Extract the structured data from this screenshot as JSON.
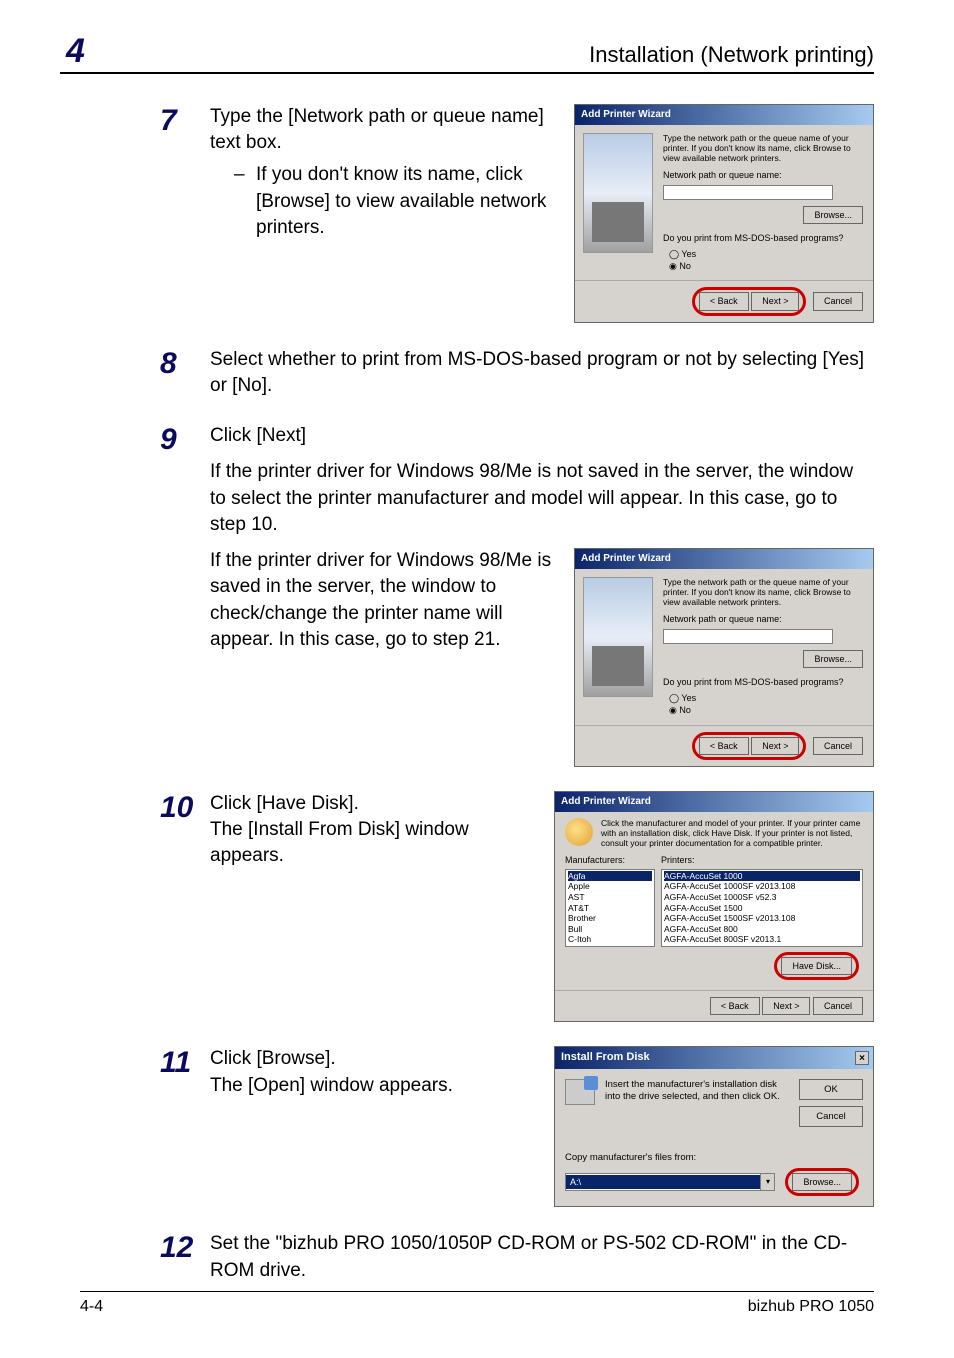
{
  "header": {
    "chapter": "4",
    "title": "Installation (Network printing)"
  },
  "steps": {
    "s7": {
      "num": "7",
      "text": "Type the [Network path or queue name] text box.",
      "bullet_dash": "–",
      "bullet": "If you don't know its name, click [Browse] to view available network printers."
    },
    "s8": {
      "num": "8",
      "text": "Select whether to print from MS-DOS-based program or not by selecting [Yes] or [No]."
    },
    "s9": {
      "num": "9",
      "line1": "Click [Next]",
      "para1": "If the printer driver for Windows 98/Me is not saved in the server, the window to select the printer manufacturer and model will appear. In this case, go to step 10.",
      "para2": "If the printer driver for Windows 98/Me is saved in the server, the window to check/change the printer name will appear. In this case, go to step 21."
    },
    "s10": {
      "num": "10",
      "line1": "Click [Have Disk].",
      "line2": "The [Install From Disk] window appears."
    },
    "s11": {
      "num": "11",
      "line1": "Click [Browse].",
      "line2": "The [Open] window appears."
    },
    "s12": {
      "num": "12",
      "text": "Set the \"bizhub PRO 1050/1050P CD-ROM or PS-502 CD-ROM\" in the CD-ROM drive."
    }
  },
  "wizard_net": {
    "title": "Add Printer Wizard",
    "note": "Type the network path or the queue name of your printer. If you don't know its name, click Browse to view available network printers.",
    "path_label": "Network path or queue name:",
    "browse": "Browse...",
    "msdos_q": "Do you print from MS-DOS-based programs?",
    "yes": "Yes",
    "no": "No",
    "back": "< Back",
    "next": "Next >",
    "cancel": "Cancel"
  },
  "wizard_mfr": {
    "title": "Add Printer Wizard",
    "note": "Click the manufacturer and model of your printer. If your printer came with an installation disk, click Have Disk. If your printer is not listed, consult your printer documentation for a compatible printer.",
    "mfr_label": "Manufacturers:",
    "prn_label": "Printers:",
    "manufacturers": [
      "Agfa",
      "Apple",
      "AST",
      "AT&T",
      "Brother",
      "Bull",
      "C-Itoh"
    ],
    "printers": [
      "AGFA-AccuSet 1000",
      "AGFA-AccuSet 1000SF v2013.108",
      "AGFA-AccuSet 1000SF v52.3",
      "AGFA-AccuSet 1500",
      "AGFA-AccuSet 1500SF v2013.108",
      "AGFA-AccuSet 800",
      "AGFA-AccuSet 800SF v2013.1"
    ],
    "have_disk": "Have Disk...",
    "back": "< Back",
    "next": "Next >",
    "cancel": "Cancel"
  },
  "install_from_disk": {
    "title": "Install From Disk",
    "text": "Insert the manufacturer's installation disk into the drive selected, and then click OK.",
    "ok": "OK",
    "cancel": "Cancel",
    "copy_label": "Copy manufacturer's files from:",
    "combo_value": "A:\\",
    "browse": "Browse..."
  },
  "footer": {
    "page": "4-4",
    "product": "bizhub PRO 1050"
  }
}
